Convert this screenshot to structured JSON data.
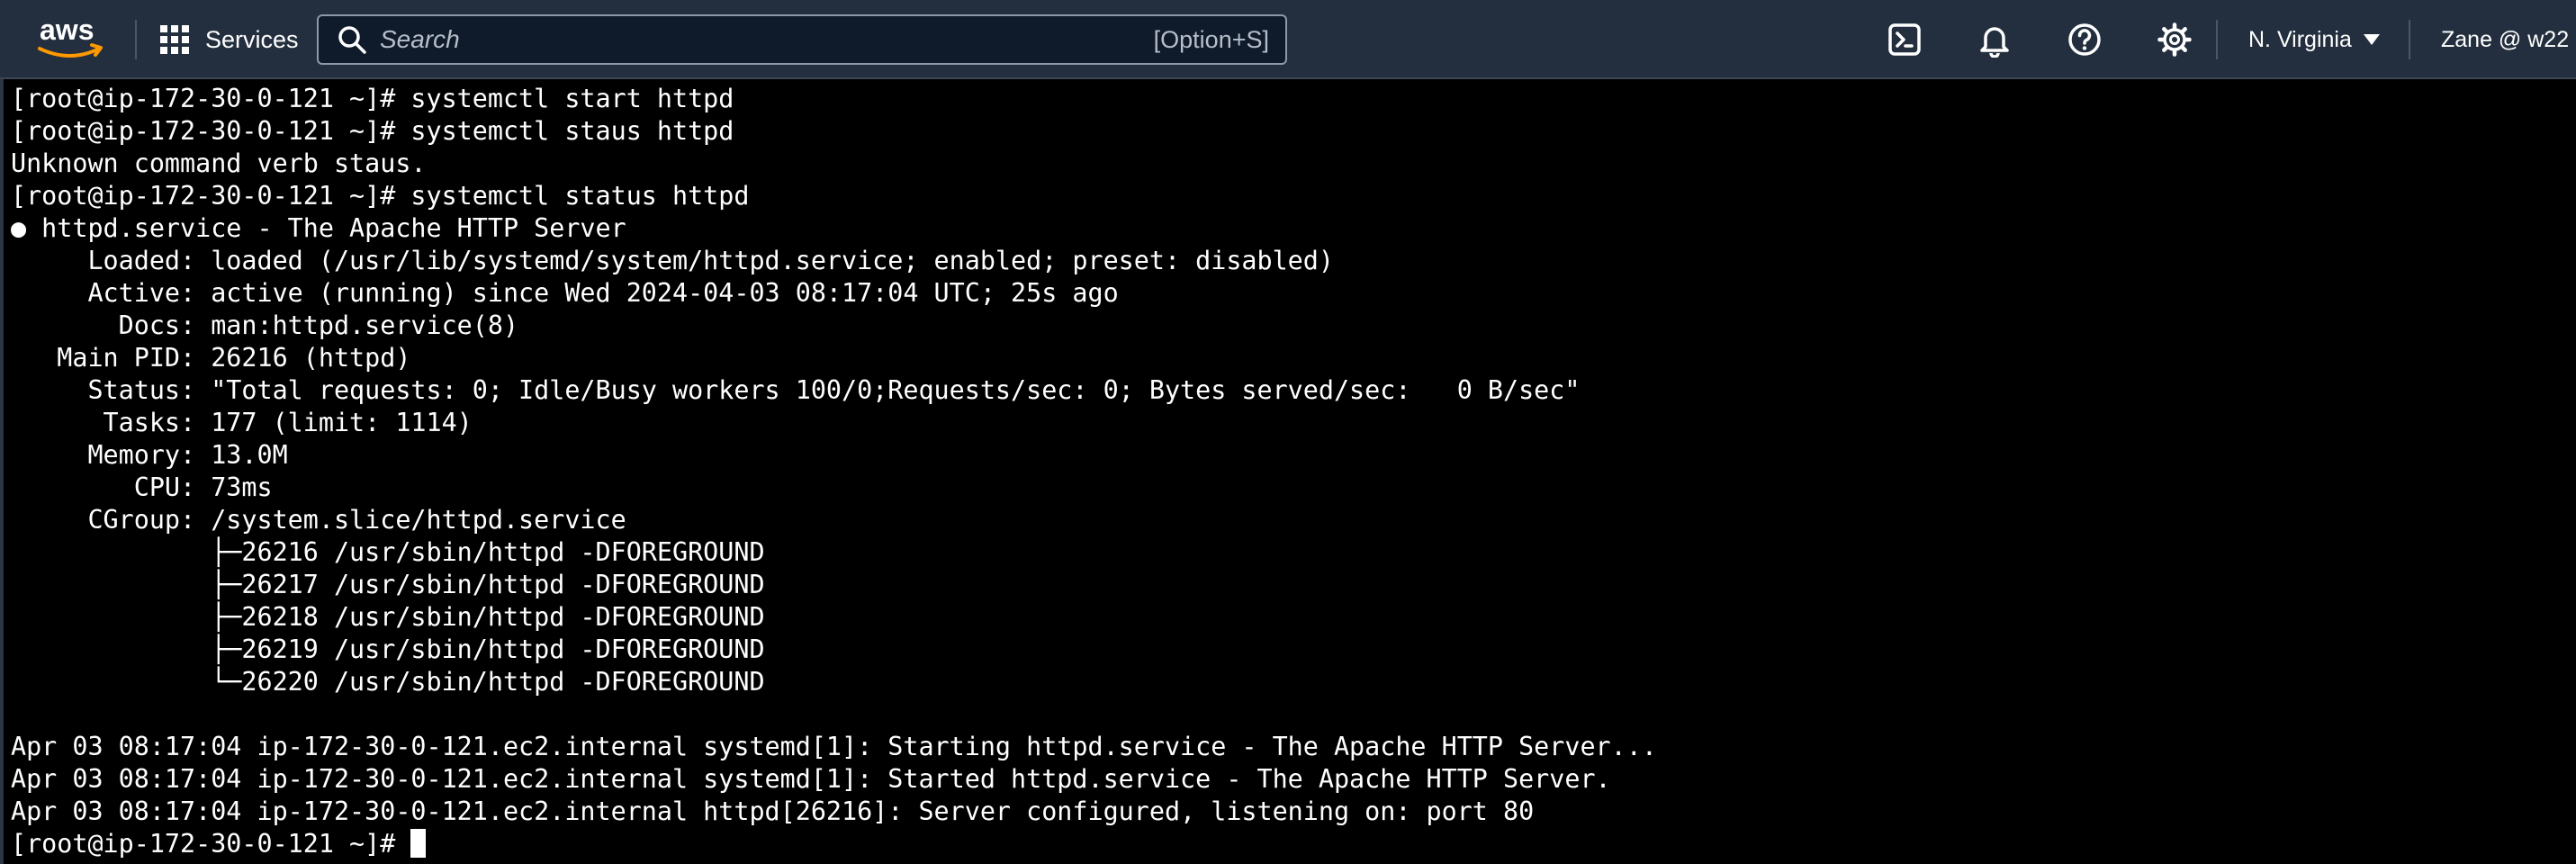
{
  "header": {
    "logo_text": "aws",
    "services_label": "Services",
    "search_placeholder": "Search",
    "search_shortcut": "[Option+S]",
    "region_label": "N. Virginia",
    "account_label": "Zane @ w22",
    "icons": [
      "cloudshell-icon",
      "bell-icon",
      "help-icon",
      "settings-icon"
    ]
  },
  "terminal": {
    "lines": [
      "[root@ip-172-30-0-121 ~]# systemctl start httpd",
      "[root@ip-172-30-0-121 ~]# systemctl staus httpd",
      "Unknown command verb staus.",
      "[root@ip-172-30-0-121 ~]# systemctl status httpd",
      "● httpd.service - The Apache HTTP Server",
      "     Loaded: loaded (/usr/lib/systemd/system/httpd.service; enabled; preset: disabled)",
      "     Active: active (running) since Wed 2024-04-03 08:17:04 UTC; 25s ago",
      "       Docs: man:httpd.service(8)",
      "   Main PID: 26216 (httpd)",
      "     Status: \"Total requests: 0; Idle/Busy workers 100/0;Requests/sec: 0; Bytes served/sec:   0 B/sec\"",
      "      Tasks: 177 (limit: 1114)",
      "     Memory: 13.0M",
      "        CPU: 73ms",
      "     CGroup: /system.slice/httpd.service",
      "             ├─26216 /usr/sbin/httpd -DFOREGROUND",
      "             ├─26217 /usr/sbin/httpd -DFOREGROUND",
      "             ├─26218 /usr/sbin/httpd -DFOREGROUND",
      "             ├─26219 /usr/sbin/httpd -DFOREGROUND",
      "             └─26220 /usr/sbin/httpd -DFOREGROUND",
      "",
      "Apr 03 08:17:04 ip-172-30-0-121.ec2.internal systemd[1]: Starting httpd.service - The Apache HTTP Server...",
      "Apr 03 08:17:04 ip-172-30-0-121.ec2.internal systemd[1]: Started httpd.service - The Apache HTTP Server.",
      "Apr 03 08:17:04 ip-172-30-0-121.ec2.internal httpd[26216]: Server configured, listening on: port 80"
    ],
    "prompt": "[root@ip-172-30-0-121 ~]# "
  },
  "colors": {
    "header_bg": "#232f3e",
    "terminal_bg": "#000000",
    "terminal_text": "#ffffff",
    "aws_smile": "#ff9900"
  }
}
